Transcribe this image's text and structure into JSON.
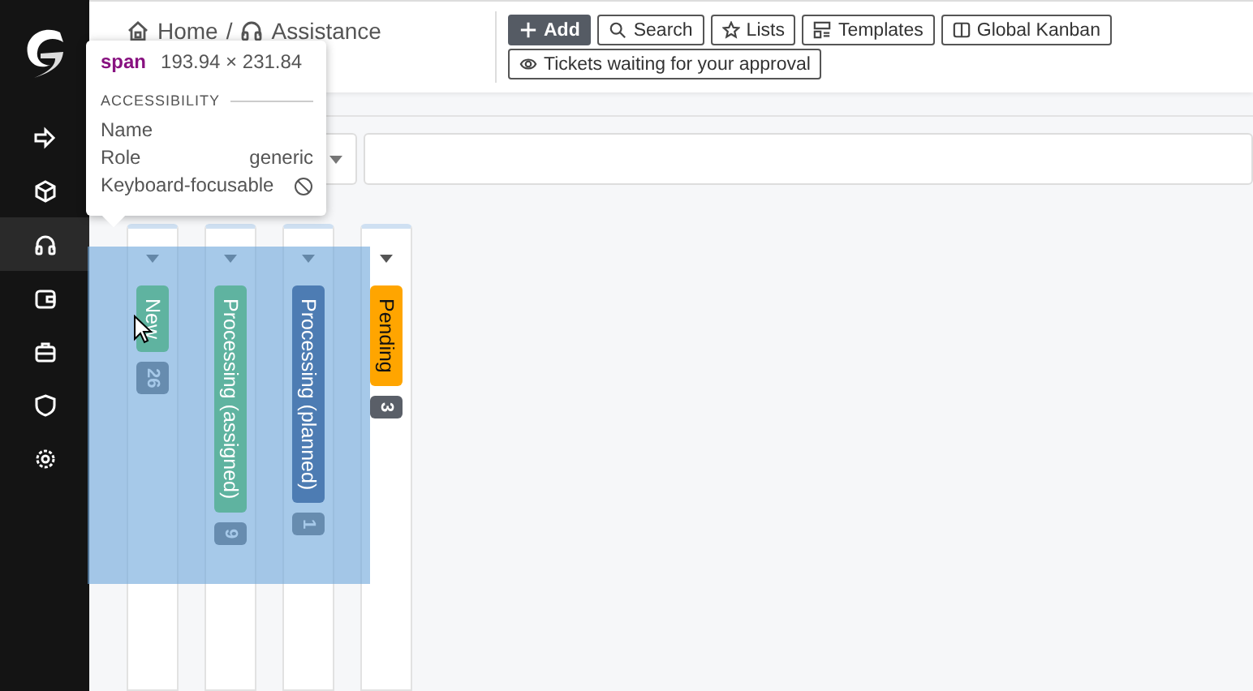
{
  "sidebar": {
    "items": [
      {
        "selected": false
      },
      {
        "selected": false
      },
      {
        "selected": true
      },
      {
        "selected": false
      },
      {
        "selected": false
      },
      {
        "selected": false
      },
      {
        "selected": false
      }
    ]
  },
  "breadcrumb": [
    "Home",
    "/",
    "Assistance"
  ],
  "toolbar": {
    "buttons": [
      {
        "label": "Add",
        "kind": "primary"
      },
      {
        "label": "Search",
        "kind": "outline"
      },
      {
        "label": "Lists",
        "kind": "outline"
      },
      {
        "label": "Templates",
        "kind": "outline"
      },
      {
        "label": "Global Kanban",
        "kind": "outline"
      },
      {
        "label": "Tickets waiting for your approval",
        "kind": "outline"
      }
    ]
  },
  "kanban": {
    "columns": [
      {
        "title": "New",
        "count": "26",
        "color": "#5fb3a0"
      },
      {
        "title": "Processing (assigned)",
        "count": "9",
        "color": "#5fb3a0"
      },
      {
        "title": "Processing (planned)",
        "count": "1",
        "color": "#4d7cb3"
      },
      {
        "title": "Pending",
        "count": "3",
        "color": "#ffa500"
      }
    ]
  },
  "inspector_tooltip": {
    "tag": "span",
    "size": "193.94 × 231.84",
    "section": "ACCESSIBILITY",
    "rows": [
      {
        "label": "Name"
      },
      {
        "label": "Role",
        "value": "generic"
      },
      {
        "label": "Keyboard-focusable"
      }
    ]
  }
}
